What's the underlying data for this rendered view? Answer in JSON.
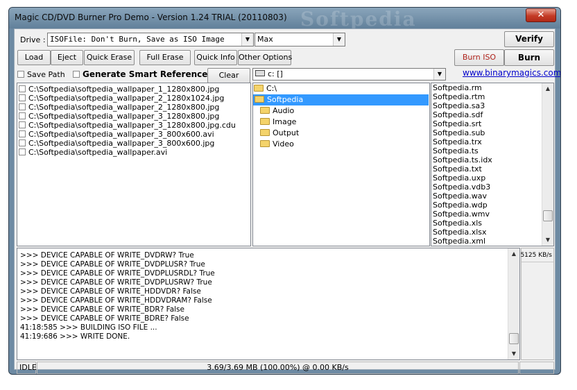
{
  "window": {
    "title": "Magic CD/DVD Burner Pro Demo - Version 1.24 TRIAL (20110803)",
    "watermark": "Softpedia",
    "close_glyph": "✕"
  },
  "toolbar": {
    "drive_label": "Drive :",
    "drive_value": "ISOFile: Don't Burn, Save as ISO Image",
    "speed_value": "Max",
    "verify_label": "Verify",
    "burn_label": "Burn",
    "burn_iso_label": "Burn ISO",
    "buttons": [
      "Load",
      "Eject",
      "Quick Erase",
      "Full Erase",
      "Quick Info",
      "Other Options"
    ]
  },
  "options": {
    "save_path_label": "Save Path",
    "smart_refs_label": "Generate Smart References",
    "clear_label": "Clear"
  },
  "files": [
    "C:\\Softpedia\\softpedia_wallpaper_1_1280x800.jpg",
    "C:\\Softpedia\\softpedia_wallpaper_2_1280x1024.jpg",
    "C:\\Softpedia\\softpedia_wallpaper_2_1280x800.jpg",
    "C:\\Softpedia\\softpedia_wallpaper_3_1280x800.jpg",
    "C:\\Softpedia\\softpedia_wallpaper_3_1280x800.jpg.cdu",
    "C:\\Softpedia\\softpedia_wallpaper_3_800x600.avi",
    "C:\\Softpedia\\softpedia_wallpaper_3_800x600.jpg",
    "C:\\Softpedia\\softpedia_wallpaper.avi"
  ],
  "drive_select": {
    "value": "c: []"
  },
  "link": {
    "text": "www.binarymagics.com",
    "color": "#0000cc"
  },
  "tree": {
    "root": "C:\\",
    "selected": "Softpedia",
    "children": [
      "Audio",
      "Image",
      "Output",
      "Video"
    ],
    "selection_color": "#3399ff"
  },
  "file_list": [
    "Softpedia.rm",
    "Softpedia.rtm",
    "Softpedia.sa3",
    "Softpedia.sdf",
    "Softpedia.srt",
    "Softpedia.sub",
    "Softpedia.trx",
    "Softpedia.ts",
    "Softpedia.ts.idx",
    "Softpedia.txt",
    "Softpedia.uxp",
    "Softpedia.vdb3",
    "Softpedia.wav",
    "Softpedia.wdp",
    "Softpedia.wmv",
    "Softpedia.xls",
    "Softpedia.xlsx",
    "Softpedia.xml"
  ],
  "log": [
    ">>> DEVICE CAPABLE OF WRITE_DVDRW? True",
    ">>> DEVICE CAPABLE OF WRITE_DVDPLUSR? True",
    ">>> DEVICE CAPABLE OF WRITE_DVDPLUSRDL? True",
    ">>> DEVICE CAPABLE OF WRITE_DVDPLUSRW? True",
    ">>> DEVICE CAPABLE OF WRITE_HDDVDR? False",
    ">>> DEVICE CAPABLE OF WRITE_HDDVDRAM? False",
    ">>> DEVICE CAPABLE OF WRITE_BDR? False",
    ">>> DEVICE CAPABLE OF WRITE_BDRE? False",
    "41:18:585 >>> BUILDING ISO FILE ...",
    "41:19:686 >>> WRITE DONE."
  ],
  "speed_readout": "5125 KB/s",
  "status": {
    "state": "IDLE",
    "progress_text": "3.69/3.69 MB (100.00%) @ 0.00 KB/s"
  }
}
